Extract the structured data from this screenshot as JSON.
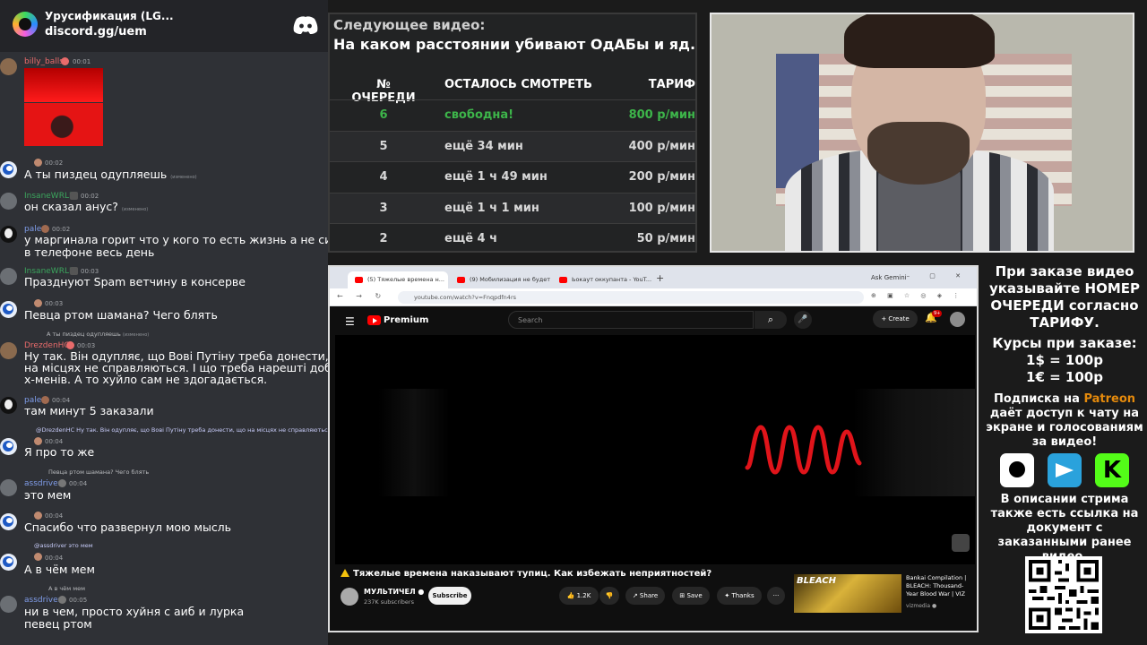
{
  "chat": {
    "server_name": "Урусификация (LG...",
    "invite_link": "discord.gg/uem",
    "messages": [
      {
        "user": "billy_balls",
        "time": "00:01",
        "user_color": "#e96b6b",
        "text": "",
        "avatar": "face"
      },
      {
        "user": "",
        "time": "00:02",
        "text": "А ты пиздец одупляешь",
        "edited": "(изменено)",
        "avatar": "blue"
      },
      {
        "user": "InsaneWRLD",
        "time": "00:02",
        "user_color": "#3ba55d",
        "text": "он сказал анус?",
        "edited": "(изменено)",
        "avatar": "gray"
      },
      {
        "user": "pale",
        "time": "00:02",
        "user_color": "#7f9ce8",
        "text": "у маргинала горит что у кого то есть жизнь а не сидеть",
        "text2": "в телефоне весь день",
        "avatar": "dark"
      },
      {
        "user": "InsaneWRLD",
        "time": "00:03",
        "user_color": "#3ba55d",
        "text": "Празднуют Spam ветчину в консерве",
        "avatar": "gray"
      },
      {
        "user": "",
        "time": "00:03",
        "text": "Певца ртом шамана? Чего блять",
        "avatar": "blue"
      },
      {
        "reply": "А ты пиздец одупляешь",
        "reply_edited": "(изменено)",
        "user": "DrezdenHC",
        "time": "00:03",
        "user_color": "#e96b6b",
        "text": "Ну так. Він одупляє, що Вові Путіну треба донести, що",
        "text2": "на місцях не справляються. І що треба нарешті добити",
        "text3": "х-менів. А то хуйло сам не здогадається.",
        "avatar": "face"
      },
      {
        "user": "pale",
        "time": "00:04",
        "user_color": "#7f9ce8",
        "text": "там минут 5 заказали",
        "avatar": "dark"
      },
      {
        "reply": "@DrezdenHC Ну так. Він одупляє, що Вові Путіну треба донести, що на місцях не справляються. І",
        "user": "",
        "time": "00:04",
        "text": "Я про то же",
        "avatar": "blue"
      },
      {
        "reply": "Певца ртом шамана? Чего блять",
        "user": "assdriver",
        "time": "00:04",
        "user_color": "#7f9ce8",
        "text": "это мем",
        "avatar": "gray"
      },
      {
        "user": "",
        "time": "00:04",
        "text": "Спасибо что развернул мою мысль",
        "avatar": "blue"
      },
      {
        "reply": "@assdriver это мем",
        "user": "",
        "time": "00:04",
        "text": "А в чём мем",
        "avatar": "blue"
      },
      {
        "reply": "А в чём мем",
        "user": "assdriver",
        "time": "00:05",
        "user_color": "#7f9ce8",
        "text": "ни в чем, просто хуйня с аиб и лурка",
        "text2": "певец ртом",
        "avatar": "gray"
      }
    ]
  },
  "queue": {
    "title": "Следующее видео:",
    "video_name": "На каком расстоянии убивают ОдАБы и яд...",
    "headers": [
      "№ ОЧЕРЕДИ",
      "ОСТАЛОСЬ СМОТРЕТЬ",
      "ТАРИФ"
    ],
    "rows": [
      {
        "num": "6",
        "remaining": "свободна!",
        "rate": "800 р/мин"
      },
      {
        "num": "5",
        "remaining": "ещё 34 мин",
        "rate": "400 р/мин"
      },
      {
        "num": "4",
        "remaining": "ещё 1 ч 49 мин",
        "rate": "200 р/мин"
      },
      {
        "num": "3",
        "remaining": "ещё 1 ч 1 мин",
        "rate": "100 р/мин"
      },
      {
        "num": "2",
        "remaining": "ещё 4 ч",
        "rate": "50 р/мин"
      }
    ],
    "highlight_color": "#3db54a"
  },
  "browser": {
    "tabs": [
      {
        "label": "(5) Тяжелые времена н..."
      },
      {
        "label": "(9) Мобилизация не будет, ес..."
      },
      {
        "label": "Ьокaут оккупанта - YouT..."
      }
    ],
    "new_tab": "+",
    "ask_gemini": "Ask Gemini",
    "window_controls": "–  ▢  ✕",
    "nav_buttons": "← → ↻",
    "url": "youtube.com/watch?v=Fnqpdfn4rs",
    "extensions": "⊕ ▣ ☆ ◎ ◈ ⋮"
  },
  "youtube": {
    "menu_icon": "☰",
    "brand": "Premium",
    "search_placeholder": "Search",
    "search_icon": "⌕",
    "mic_icon": "🎤",
    "create_label": "+ Create",
    "bell_icon": "🔔",
    "notif_count": "9+",
    "video_title": "Тяжелые времена наказывают тупиц. Как избежать неприятностей?",
    "channel_name": "МУЛЬТИЧЕЛ ●",
    "channel_subs": "237K subscribers",
    "subscribe": "Subscribe",
    "likes": "👍 1.2K",
    "dislike": "👎",
    "share": "↗ Share",
    "save": "⊞ Save",
    "thanks": "✦ Thanks",
    "more": "···",
    "recommended": {
      "thumb_label": "BLEACH",
      "title": "Bankai Compilation | BLEACH: Thousand-Year Blood War | VIZ",
      "channel": "vizmedia ●"
    },
    "wave_color": "#e0141a"
  },
  "info": {
    "order_text": "При заказе видео указывайте НОМЕР ОЧЕРЕДИ согласно ТАРИФУ.",
    "rates_title": "Курсы при заказе:",
    "rate_usd": "1$ = 100р",
    "rate_eur": "1€ = 100р",
    "patreon_pre": "Подписка на ",
    "patreon_word": "Patreon",
    "patreon_post": " даёт доступ к чату на экране и голосованиям за видео!",
    "description": "В описании стрима также есть ссылка на документ с заказанными ранее видео."
  },
  "colors": {
    "discord_bg": "#2f3136",
    "patreon_orange": "#e58a0c",
    "telegram_blue": "#2aa2dc",
    "kick_green": "#53fc18"
  }
}
